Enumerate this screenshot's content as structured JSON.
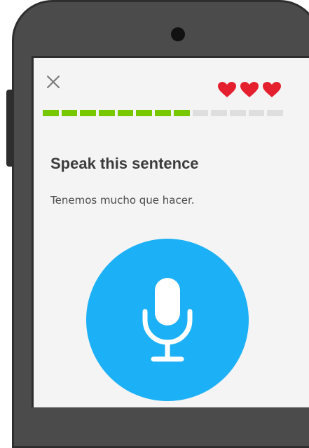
{
  "colors": {
    "accent": "#1cb0f6",
    "progress_done": "#78c800",
    "progress_todo": "#dedede",
    "heart": "#e5202e"
  },
  "header": {
    "close_icon": "close-icon",
    "hearts": [
      "heart-icon",
      "heart-icon",
      "heart-icon"
    ]
  },
  "progress": {
    "segments_total": 13,
    "segments_done": 8
  },
  "challenge": {
    "title": "Speak this sentence",
    "sentence": "Tenemos mucho que hacer.",
    "mic_icon": "microphone-icon"
  }
}
